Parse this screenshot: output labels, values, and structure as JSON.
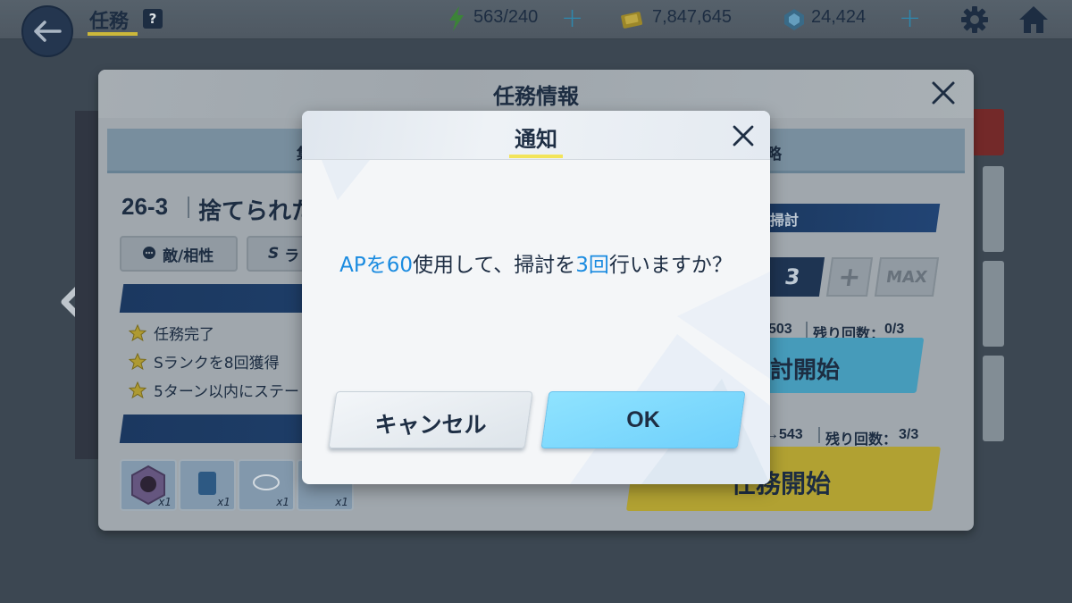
{
  "topbar": {
    "title": "任務",
    "help": "?",
    "ap": "563/240",
    "credits": "7,847,645",
    "gems": "24,424"
  },
  "mission": {
    "title": "任務情報",
    "tab_left": "集",
    "tab_right": "略",
    "stage_code": "26-3",
    "stage_name": "捨てられた",
    "chip_enemy": "敵/相性",
    "chip_rank_s": "S",
    "chip_rank_rest": "ラ",
    "objectives": [
      "任務完了",
      "Sランクを8回獲得",
      "5ターン以内にステー"
    ],
    "rewards": [
      "x1",
      "x1",
      "x1",
      "x1"
    ],
    "sweep_bar": "掃討",
    "sweep_count": "3",
    "plus": "+",
    "max": "MAX",
    "sweep_info_num": "503",
    "sweep_info_remain": "残り回数：",
    "sweep_info_frac": "0/3",
    "sweep_start": "討開始",
    "start_info_num": "→543",
    "start_info_remain": "残り回数：",
    "start_info_frac": "3/3",
    "start": "任務開始"
  },
  "dialog": {
    "title": "通知",
    "msg_ap": "APを60",
    "msg_mid": "使用して、掃討を",
    "msg_count": "3回",
    "msg_end": "行いますか？",
    "cancel": "キャンセル",
    "ok": "OK"
  },
  "colors": {
    "highlight": "#1a8be0",
    "ok_button": "#78d6fc",
    "cancel_button": "#e7ecf1",
    "title_underline": "#f2e45a"
  }
}
